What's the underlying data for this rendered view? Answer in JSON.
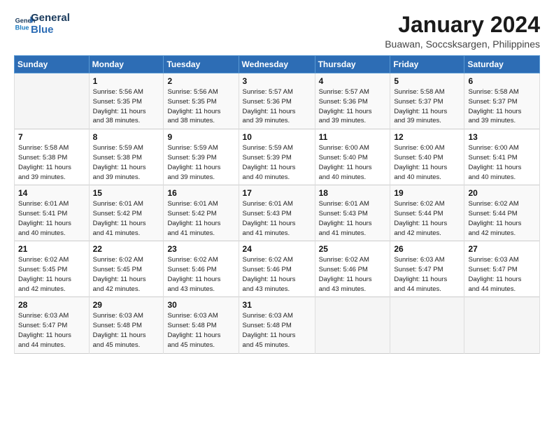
{
  "logo": {
    "line1": "General",
    "line2": "Blue"
  },
  "title": "January 2024",
  "subtitle": "Buawan, Soccsksargen, Philippines",
  "days_of_week": [
    "Sunday",
    "Monday",
    "Tuesday",
    "Wednesday",
    "Thursday",
    "Friday",
    "Saturday"
  ],
  "weeks": [
    [
      {
        "day": "",
        "info": ""
      },
      {
        "day": "1",
        "info": "Sunrise: 5:56 AM\nSunset: 5:35 PM\nDaylight: 11 hours\nand 38 minutes."
      },
      {
        "day": "2",
        "info": "Sunrise: 5:56 AM\nSunset: 5:35 PM\nDaylight: 11 hours\nand 38 minutes."
      },
      {
        "day": "3",
        "info": "Sunrise: 5:57 AM\nSunset: 5:36 PM\nDaylight: 11 hours\nand 39 minutes."
      },
      {
        "day": "4",
        "info": "Sunrise: 5:57 AM\nSunset: 5:36 PM\nDaylight: 11 hours\nand 39 minutes."
      },
      {
        "day": "5",
        "info": "Sunrise: 5:58 AM\nSunset: 5:37 PM\nDaylight: 11 hours\nand 39 minutes."
      },
      {
        "day": "6",
        "info": "Sunrise: 5:58 AM\nSunset: 5:37 PM\nDaylight: 11 hours\nand 39 minutes."
      }
    ],
    [
      {
        "day": "7",
        "info": "Sunrise: 5:58 AM\nSunset: 5:38 PM\nDaylight: 11 hours\nand 39 minutes."
      },
      {
        "day": "8",
        "info": "Sunrise: 5:59 AM\nSunset: 5:38 PM\nDaylight: 11 hours\nand 39 minutes."
      },
      {
        "day": "9",
        "info": "Sunrise: 5:59 AM\nSunset: 5:39 PM\nDaylight: 11 hours\nand 39 minutes."
      },
      {
        "day": "10",
        "info": "Sunrise: 5:59 AM\nSunset: 5:39 PM\nDaylight: 11 hours\nand 40 minutes."
      },
      {
        "day": "11",
        "info": "Sunrise: 6:00 AM\nSunset: 5:40 PM\nDaylight: 11 hours\nand 40 minutes."
      },
      {
        "day": "12",
        "info": "Sunrise: 6:00 AM\nSunset: 5:40 PM\nDaylight: 11 hours\nand 40 minutes."
      },
      {
        "day": "13",
        "info": "Sunrise: 6:00 AM\nSunset: 5:41 PM\nDaylight: 11 hours\nand 40 minutes."
      }
    ],
    [
      {
        "day": "14",
        "info": "Sunrise: 6:01 AM\nSunset: 5:41 PM\nDaylight: 11 hours\nand 40 minutes."
      },
      {
        "day": "15",
        "info": "Sunrise: 6:01 AM\nSunset: 5:42 PM\nDaylight: 11 hours\nand 41 minutes."
      },
      {
        "day": "16",
        "info": "Sunrise: 6:01 AM\nSunset: 5:42 PM\nDaylight: 11 hours\nand 41 minutes."
      },
      {
        "day": "17",
        "info": "Sunrise: 6:01 AM\nSunset: 5:43 PM\nDaylight: 11 hours\nand 41 minutes."
      },
      {
        "day": "18",
        "info": "Sunrise: 6:01 AM\nSunset: 5:43 PM\nDaylight: 11 hours\nand 41 minutes."
      },
      {
        "day": "19",
        "info": "Sunrise: 6:02 AM\nSunset: 5:44 PM\nDaylight: 11 hours\nand 42 minutes."
      },
      {
        "day": "20",
        "info": "Sunrise: 6:02 AM\nSunset: 5:44 PM\nDaylight: 11 hours\nand 42 minutes."
      }
    ],
    [
      {
        "day": "21",
        "info": "Sunrise: 6:02 AM\nSunset: 5:45 PM\nDaylight: 11 hours\nand 42 minutes."
      },
      {
        "day": "22",
        "info": "Sunrise: 6:02 AM\nSunset: 5:45 PM\nDaylight: 11 hours\nand 42 minutes."
      },
      {
        "day": "23",
        "info": "Sunrise: 6:02 AM\nSunset: 5:46 PM\nDaylight: 11 hours\nand 43 minutes."
      },
      {
        "day": "24",
        "info": "Sunrise: 6:02 AM\nSunset: 5:46 PM\nDaylight: 11 hours\nand 43 minutes."
      },
      {
        "day": "25",
        "info": "Sunrise: 6:02 AM\nSunset: 5:46 PM\nDaylight: 11 hours\nand 43 minutes."
      },
      {
        "day": "26",
        "info": "Sunrise: 6:03 AM\nSunset: 5:47 PM\nDaylight: 11 hours\nand 44 minutes."
      },
      {
        "day": "27",
        "info": "Sunrise: 6:03 AM\nSunset: 5:47 PM\nDaylight: 11 hours\nand 44 minutes."
      }
    ],
    [
      {
        "day": "28",
        "info": "Sunrise: 6:03 AM\nSunset: 5:47 PM\nDaylight: 11 hours\nand 44 minutes."
      },
      {
        "day": "29",
        "info": "Sunrise: 6:03 AM\nSunset: 5:48 PM\nDaylight: 11 hours\nand 45 minutes."
      },
      {
        "day": "30",
        "info": "Sunrise: 6:03 AM\nSunset: 5:48 PM\nDaylight: 11 hours\nand 45 minutes."
      },
      {
        "day": "31",
        "info": "Sunrise: 6:03 AM\nSunset: 5:48 PM\nDaylight: 11 hours\nand 45 minutes."
      },
      {
        "day": "",
        "info": ""
      },
      {
        "day": "",
        "info": ""
      },
      {
        "day": "",
        "info": ""
      }
    ]
  ]
}
